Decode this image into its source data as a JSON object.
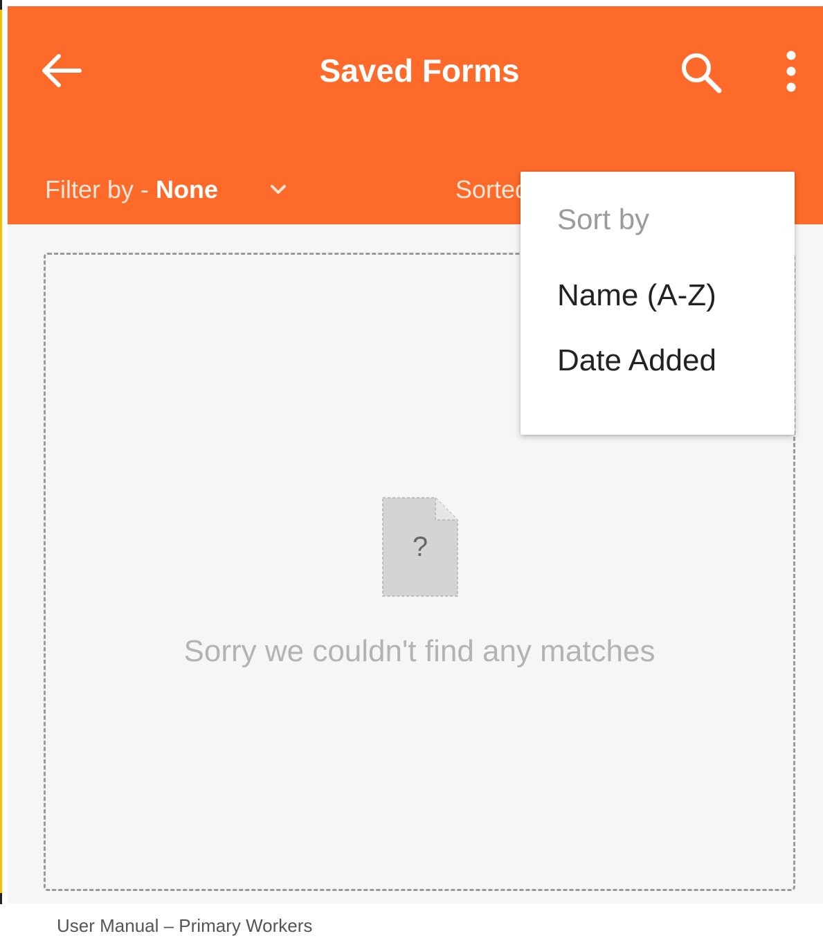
{
  "app_bar": {
    "title": "Saved Forms",
    "back_icon": "arrow-left-icon",
    "search_icon": "search-icon",
    "more_icon": "more-vert-icon",
    "filter_prefix": "Filter by - ",
    "filter_value": "None",
    "sort_label": "Sorted by"
  },
  "sort_menu": {
    "header": "Sort by",
    "options": [
      "Name (A-Z)",
      "Date Added"
    ]
  },
  "empty_state": {
    "icon_glyph": "?",
    "message": "Sorry we couldn't find any matches"
  },
  "footer": {
    "caption": "User Manual – Primary Workers"
  },
  "colors": {
    "app_bar": "#fe6a29",
    "background": "#f6f6f6",
    "menu": "#ffffff"
  }
}
